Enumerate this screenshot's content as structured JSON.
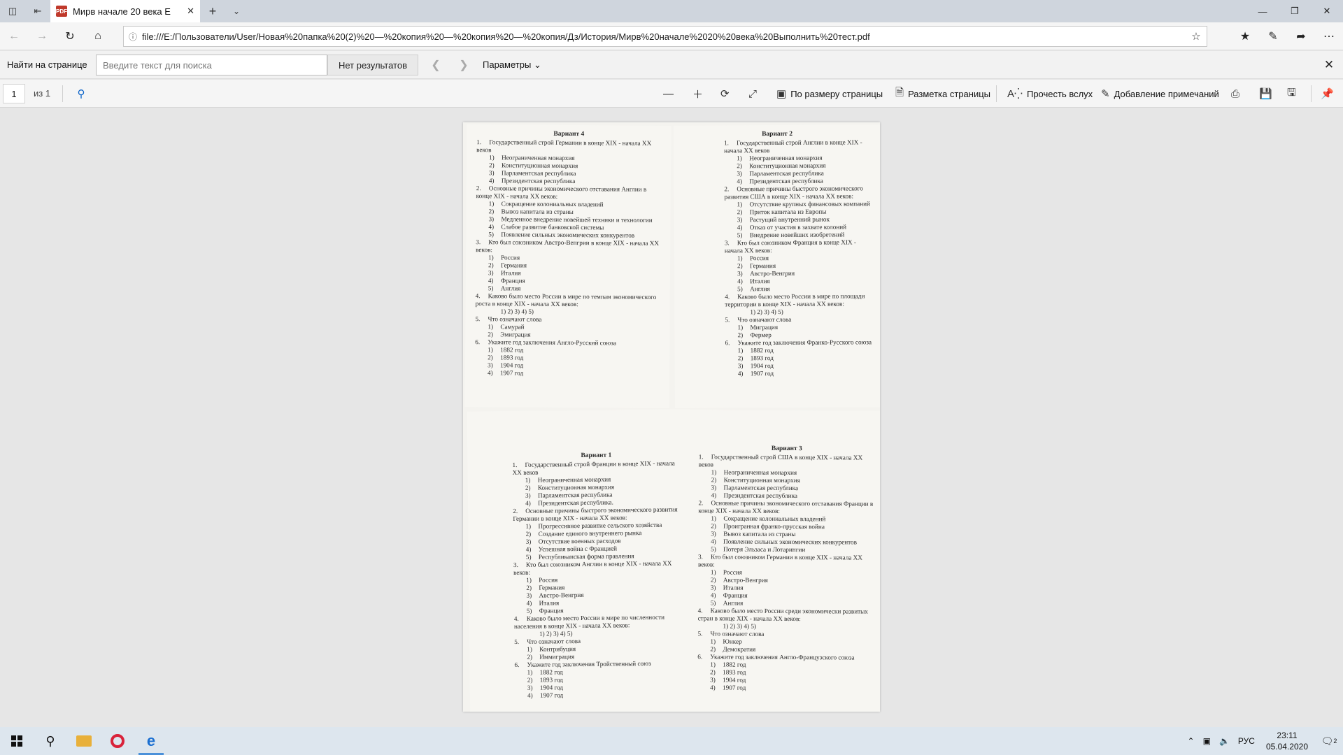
{
  "browser": {
    "tab_title": "Мирв начале 20 века Е",
    "url": "file:///E:/Пользователи/User/Новая%20папка%20(2)%20—%20копия%20—%20копия%20—%20копия/Дз/История/Мирв%20начале%2020%20века%20Выполнить%20тест.pdf",
    "new_tab": "+",
    "tabs_dropdown": "⌄"
  },
  "findbar": {
    "label": "Найти на странице",
    "placeholder": "Введите текст для поиска",
    "result": "Нет результатов",
    "options": "Параметры"
  },
  "pdf_toolbar": {
    "page": "1",
    "of": "из 1",
    "fit_page": "По размеру страницы",
    "page_layout": "Разметка страницы",
    "read_aloud": "Прочесть вслух",
    "add_notes": "Добавление примечаний"
  },
  "document": {
    "variant4": {
      "title": "Вариант 4",
      "lines": [
        {
          "k": "q",
          "n": "1.",
          "t": "Государственный строй Германии в конце XIX - начала XX веков"
        },
        {
          "k": "o",
          "n": "1)",
          "t": "Неограниченная монархия"
        },
        {
          "k": "o",
          "n": "2)",
          "t": "Конституционная монархия"
        },
        {
          "k": "o",
          "n": "3)",
          "t": "Парламентская республика"
        },
        {
          "k": "o",
          "n": "4)",
          "t": "Президентская республика"
        },
        {
          "k": "q",
          "n": "2.",
          "t": "Основные причины экономического отставания Англии в конце XIX - начала XX веков:"
        },
        {
          "k": "o",
          "n": "1)",
          "t": "Сокращение колониальных владений"
        },
        {
          "k": "o",
          "n": "2)",
          "t": "Вывоз капитала из страны"
        },
        {
          "k": "o",
          "n": "3)",
          "t": "Медленное внедрение новейшей техники и технологии"
        },
        {
          "k": "o",
          "n": "4)",
          "t": "Слабое развитие банковской системы"
        },
        {
          "k": "o",
          "n": "5)",
          "t": "Появление сильных экономических конкурентов"
        },
        {
          "k": "q",
          "n": "3.",
          "t": "Кто был союзником Австро-Венгрии в конце XIX - начала XX веков:"
        },
        {
          "k": "o",
          "n": "1)",
          "t": "Россия"
        },
        {
          "k": "o",
          "n": "2)",
          "t": "Германия"
        },
        {
          "k": "o",
          "n": "3)",
          "t": "Италия"
        },
        {
          "k": "o",
          "n": "4)",
          "t": "Франция"
        },
        {
          "k": "o",
          "n": "5)",
          "t": "Англия"
        },
        {
          "k": "q",
          "n": "4.",
          "t": "Каково было место России в мире по темпам экономического роста в конце XIX - начала XX веков:"
        },
        {
          "k": "o",
          "n": "",
          "t": "1) 2) 3) 4) 5)"
        },
        {
          "k": "q",
          "n": "5.",
          "t": "Что означают слова"
        },
        {
          "k": "o",
          "n": "1)",
          "t": "Самурай"
        },
        {
          "k": "o",
          "n": "2)",
          "t": "Эмиграция"
        },
        {
          "k": "q",
          "n": "6.",
          "t": "Укажите год заключения Англо-Русский союза"
        },
        {
          "k": "o",
          "n": "1)",
          "t": "1882 год"
        },
        {
          "k": "o",
          "n": "2)",
          "t": "1893 год"
        },
        {
          "k": "o",
          "n": "3)",
          "t": "1904 год"
        },
        {
          "k": "o",
          "n": "4)",
          "t": "1907 год"
        }
      ]
    },
    "variant2": {
      "title": "Вариант 2",
      "lines": [
        {
          "k": "q",
          "n": "1.",
          "t": "Государственный строй Англии в конце XIX - начала XX веков"
        },
        {
          "k": "o",
          "n": "1)",
          "t": "Неограниченная монархия"
        },
        {
          "k": "o",
          "n": "2)",
          "t": "Конституционная монархия"
        },
        {
          "k": "o",
          "n": "3)",
          "t": "Парламентская республика"
        },
        {
          "k": "o",
          "n": "4)",
          "t": "Президентская республика"
        },
        {
          "k": "q",
          "n": "2.",
          "t": "Основные причины быстрого экономического развития США в конце XIX - начала XX веков:"
        },
        {
          "k": "o",
          "n": "1)",
          "t": "Отсутствие крупных финансовых компаний"
        },
        {
          "k": "o",
          "n": "2)",
          "t": "Приток капитала из Европы"
        },
        {
          "k": "o",
          "n": "3)",
          "t": "Растущий внутренний рынок"
        },
        {
          "k": "o",
          "n": "4)",
          "t": "Отказ от участия в захвате колоний"
        },
        {
          "k": "o",
          "n": "5)",
          "t": "Внедрение новейших изобретений"
        },
        {
          "k": "q",
          "n": "3.",
          "t": "Кто был союзником Франция в конце XIX - начала XX веков:"
        },
        {
          "k": "o",
          "n": "1)",
          "t": "Россия"
        },
        {
          "k": "o",
          "n": "2)",
          "t": "Германия"
        },
        {
          "k": "o",
          "n": "3)",
          "t": "Австро-Венгрия"
        },
        {
          "k": "o",
          "n": "4)",
          "t": "Италия"
        },
        {
          "k": "o",
          "n": "5)",
          "t": "Англия"
        },
        {
          "k": "q",
          "n": "4.",
          "t": "Каково было место России в мире по площади территории в конце XIX - начала XX веков:"
        },
        {
          "k": "o",
          "n": "",
          "t": "1) 2) 3) 4) 5)"
        },
        {
          "k": "q",
          "n": "5.",
          "t": "Что означают слова"
        },
        {
          "k": "o",
          "n": "1)",
          "t": "Миграция"
        },
        {
          "k": "o",
          "n": "2)",
          "t": "Фермер"
        },
        {
          "k": "q",
          "n": "6.",
          "t": "Укажите год заключения Франко-Русского союза"
        },
        {
          "k": "o",
          "n": "1)",
          "t": "1882 год"
        },
        {
          "k": "o",
          "n": "2)",
          "t": "1893 год"
        },
        {
          "k": "o",
          "n": "3)",
          "t": "1904 год"
        },
        {
          "k": "o",
          "n": "4)",
          "t": "1907 год"
        }
      ]
    },
    "variant1": {
      "title": "Вариант 1",
      "lines": [
        {
          "k": "q",
          "n": "1.",
          "t": "Государственный строй Франции в конце XIX - начала XX веков"
        },
        {
          "k": "o",
          "n": "1)",
          "t": "Неограниченная монархия"
        },
        {
          "k": "o",
          "n": "2)",
          "t": "Конституционная монархия"
        },
        {
          "k": "o",
          "n": "3)",
          "t": "Парламентская республика"
        },
        {
          "k": "o",
          "n": "4)",
          "t": "Президентская республика."
        },
        {
          "k": "q",
          "n": "2.",
          "t": "Основные причины быстрого экономического развития Германии в конце XIX - начала XX веков:"
        },
        {
          "k": "o",
          "n": "1)",
          "t": "Прогрессивное развитие сельского хозяйства"
        },
        {
          "k": "o",
          "n": "2)",
          "t": "Создание единого внутреннего рынка"
        },
        {
          "k": "o",
          "n": "3)",
          "t": "Отсутствие военных расходов"
        },
        {
          "k": "o",
          "n": "4)",
          "t": "Успешная война с Францией"
        },
        {
          "k": "o",
          "n": "5)",
          "t": "Республиканская форма правления"
        },
        {
          "k": "q",
          "n": "3.",
          "t": "Кто был союзником Англии в конце XIX - начала XX веков:"
        },
        {
          "k": "o",
          "n": "1)",
          "t": "Россия"
        },
        {
          "k": "o",
          "n": "2)",
          "t": "Германия"
        },
        {
          "k": "o",
          "n": "3)",
          "t": "Австро-Венгрия"
        },
        {
          "k": "o",
          "n": "4)",
          "t": "Италия"
        },
        {
          "k": "o",
          "n": "5)",
          "t": "Франция"
        },
        {
          "k": "q",
          "n": "4.",
          "t": "Каково было место России в мире по численности населения в конце XIX - начала XX веков:"
        },
        {
          "k": "o",
          "n": "",
          "t": "1) 2) 3) 4) 5)"
        },
        {
          "k": "q",
          "n": "5.",
          "t": "Что означают слова"
        },
        {
          "k": "o",
          "n": "1)",
          "t": "Контрибуция"
        },
        {
          "k": "o",
          "n": "2)",
          "t": "Иммиграция"
        },
        {
          "k": "q",
          "n": "6.",
          "t": "Укажите год заключения Тройственный союз"
        },
        {
          "k": "o",
          "n": "1)",
          "t": "1882 год"
        },
        {
          "k": "o",
          "n": "2)",
          "t": "1893 год"
        },
        {
          "k": "o",
          "n": "3)",
          "t": "1904 год"
        },
        {
          "k": "o",
          "n": "4)",
          "t": "1907 год"
        }
      ]
    },
    "variant3": {
      "title": "Вариант 3",
      "lines": [
        {
          "k": "q",
          "n": "1.",
          "t": "Государственный строй США в конце XIX - начала XX веков"
        },
        {
          "k": "o",
          "n": "1)",
          "t": "Неограниченная монархия"
        },
        {
          "k": "o",
          "n": "2)",
          "t": "Конституционная монархия"
        },
        {
          "k": "o",
          "n": "3)",
          "t": "Парламентская республика"
        },
        {
          "k": "o",
          "n": "4)",
          "t": "Президентская республика"
        },
        {
          "k": "q",
          "n": "2.",
          "t": "Основные причины экономического отставания Франции в конце XIX - начала XX веков:"
        },
        {
          "k": "o",
          "n": "1)",
          "t": "Сокращение колониальных владений"
        },
        {
          "k": "o",
          "n": "2)",
          "t": "Проигранная франко-прусская война"
        },
        {
          "k": "o",
          "n": "3)",
          "t": "Вывоз капитала из страны"
        },
        {
          "k": "o",
          "n": "4)",
          "t": "Появление сильных экономических конкурентов"
        },
        {
          "k": "o",
          "n": "5)",
          "t": "Потеря Эльзаса и Лотарингии"
        },
        {
          "k": "q",
          "n": "3.",
          "t": "Кто был союзником Германии в конце XIX - начала XX веков:"
        },
        {
          "k": "o",
          "n": "1)",
          "t": "Россия"
        },
        {
          "k": "o",
          "n": "2)",
          "t": "Австро-Венгрия"
        },
        {
          "k": "o",
          "n": "3)",
          "t": "Италия"
        },
        {
          "k": "o",
          "n": "4)",
          "t": "Франция"
        },
        {
          "k": "o",
          "n": "5)",
          "t": "Англия"
        },
        {
          "k": "q",
          "n": "4.",
          "t": "Каково было место России среди экономически развитых стран в конце XIX - начала XX веков:"
        },
        {
          "k": "o",
          "n": "",
          "t": "1) 2) 3) 4) 5)"
        },
        {
          "k": "q",
          "n": "5.",
          "t": "Что означают слова"
        },
        {
          "k": "o",
          "n": "1)",
          "t": "Юнкер"
        },
        {
          "k": "o",
          "n": "2)",
          "t": "Демократия"
        },
        {
          "k": "q",
          "n": "6.",
          "t": "Укажите год заключения Англо-Французского союза"
        },
        {
          "k": "o",
          "n": "1)",
          "t": "1882 год"
        },
        {
          "k": "o",
          "n": "2)",
          "t": "1893 год"
        },
        {
          "k": "o",
          "n": "3)",
          "t": "1904 год"
        },
        {
          "k": "o",
          "n": "4)",
          "t": "1907 год"
        }
      ]
    }
  },
  "taskbar": {
    "language": "РУС",
    "time": "23:11",
    "date": "05.04.2020",
    "notifications": "2"
  }
}
